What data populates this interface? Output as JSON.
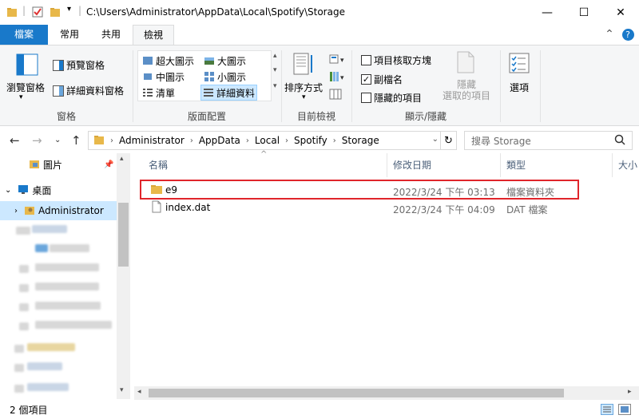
{
  "window": {
    "title_path": "C:\\Users\\Administrator\\AppData\\Local\\Spotify\\Storage",
    "controls": {
      "minimize": "—",
      "maximize": "☐",
      "close": "✕"
    }
  },
  "ribbon_tabs": [
    "檔案",
    "常用",
    "共用",
    "檢視"
  ],
  "ribbon_right": {
    "collapse": "⌃",
    "help": "?"
  },
  "panes_group": {
    "nav_pane": "瀏覽窗格",
    "preview_pane": "預覽窗格",
    "details_pane": "詳細資料窗格",
    "label": "窗格"
  },
  "layout_group": {
    "items": [
      "超大圖示",
      "大圖示",
      "中圖示",
      "小圖示",
      "清單",
      "詳細資料"
    ],
    "label": "版面配置"
  },
  "current_view_group": {
    "sort_by": "排序方式",
    "label": "目前檢視"
  },
  "show_hide_group": {
    "item_checkboxes": {
      "label": "項目核取方塊",
      "checked": false
    },
    "file_extensions": {
      "label": "副檔名",
      "checked": true
    },
    "hidden_items": {
      "label": "隱藏的項目",
      "checked": false
    },
    "hide_selected": "隱藏\n選取的項目",
    "label": "顯示/隱藏"
  },
  "options": {
    "label": "選項"
  },
  "address": {
    "crumbs": [
      "Administrator",
      "AppData",
      "Local",
      "Spotify",
      "Storage"
    ],
    "search_placeholder": "搜尋 Storage"
  },
  "navigation": {
    "items": [
      {
        "label": "圖片"
      },
      {
        "label": "桌面"
      },
      {
        "label": "Administrator"
      }
    ]
  },
  "columns": [
    "名稱",
    "修改日期",
    "類型",
    "大小"
  ],
  "files": [
    {
      "name": "e9",
      "modified": "2022/3/24 下午 03:13",
      "type": "檔案資料夾",
      "icon": "folder-icon"
    },
    {
      "name": "index.dat",
      "modified": "2022/3/24 下午 04:09",
      "type": "DAT 檔案",
      "icon": "file-icon"
    }
  ],
  "status": {
    "item_count": "2 個項目"
  },
  "colors": {
    "accent": "#1979ca",
    "selection": "#cce8ff",
    "highlight_box": "#e0252b",
    "folder": "#e8b84a"
  }
}
